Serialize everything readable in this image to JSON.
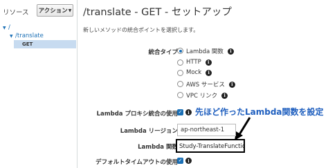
{
  "sidebar": {
    "title": "リソース",
    "action_button": "アクション",
    "tree": {
      "root": "/",
      "translate": "/translate",
      "get": "GET"
    }
  },
  "main": {
    "title": "/translate - GET - セットアップ",
    "subtitle": "新しいメソッドの統合ポイントを選択します。",
    "integration_type_label": "統合タイプ",
    "integration_options": [
      {
        "label": "Lambda 関数",
        "selected": true
      },
      {
        "label": "HTTP",
        "selected": false
      },
      {
        "label": "Mock",
        "selected": false
      },
      {
        "label": "AWS サービス",
        "selected": false
      },
      {
        "label": "VPC リンク",
        "selected": false
      }
    ],
    "proxy_label": "Lambda プロキシ統合の使用",
    "proxy_checked": true,
    "region_label": "Lambda リージョン",
    "region_value": "ap-northeast-1",
    "function_label": "Lambda 関数",
    "function_value": "Study-TranslateFunction",
    "timeout_label": "デフォルトタイムアウトの使用",
    "timeout_checked": true,
    "annotation": "先ほど作ったLambda関数を設定"
  },
  "colors": {
    "accent": "#1a6fb5",
    "annotation": "#1f5fbf",
    "selected_row": "#c7dbf0"
  }
}
